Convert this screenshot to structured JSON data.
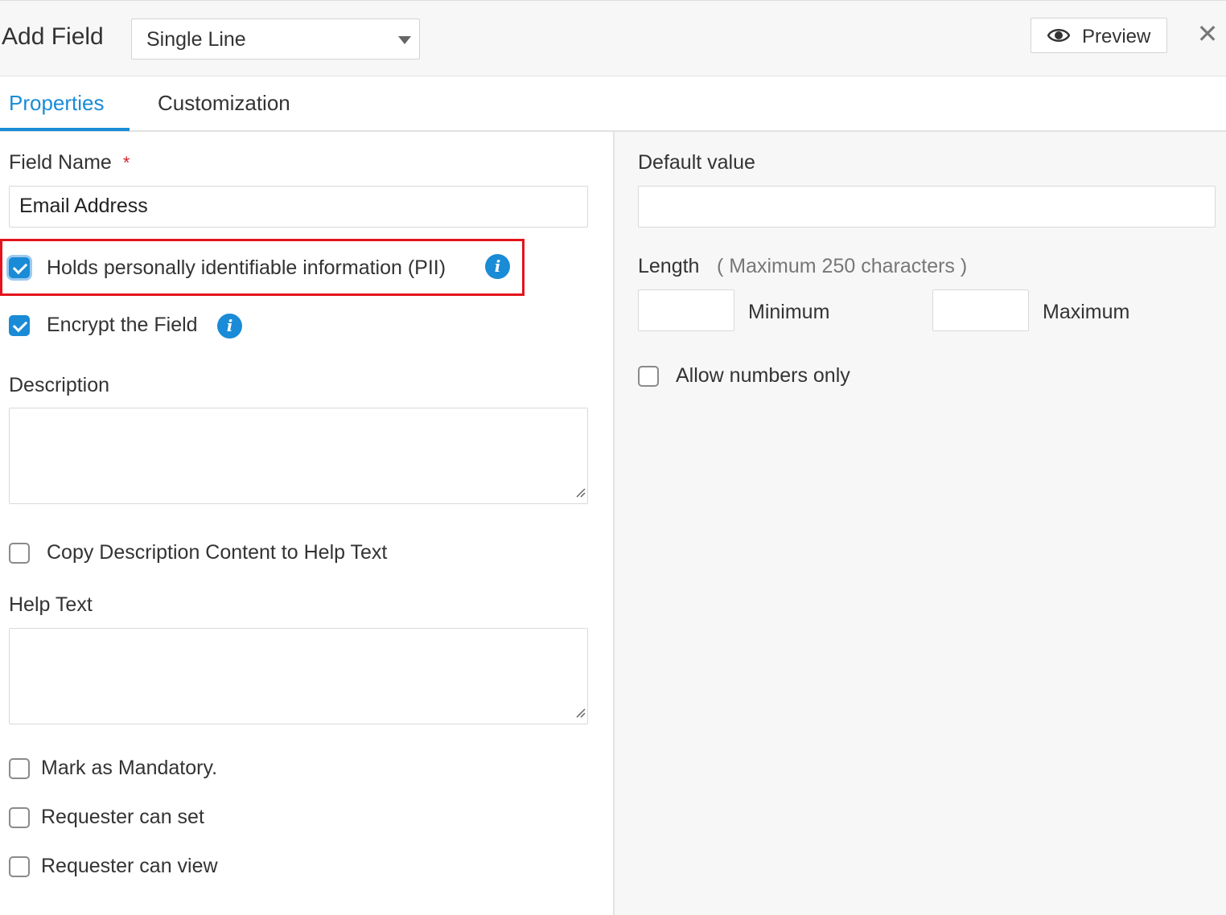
{
  "header": {
    "title": "Add Field",
    "field_type": "Single Line",
    "preview_label": "Preview",
    "close_glyph": "✕"
  },
  "tabs": [
    {
      "label": "Properties",
      "active": true
    },
    {
      "label": "Customization",
      "active": false
    }
  ],
  "left": {
    "field_name": {
      "label": "Field Name",
      "required_mark": "*",
      "value": "Email Address"
    },
    "pii": {
      "label": "Holds personally identifiable information (PII)",
      "checked": true
    },
    "encrypt": {
      "label": "Encrypt the Field",
      "checked": true
    },
    "description": {
      "label": "Description",
      "value": ""
    },
    "copy_description": {
      "label": "Copy Description Content to Help Text",
      "checked": false
    },
    "help_text": {
      "label": "Help Text",
      "value": ""
    },
    "mandatory": {
      "label": "Mark as Mandatory.",
      "checked": false
    },
    "requester_set": {
      "label": "Requester can set",
      "checked": false
    },
    "requester_view": {
      "label": "Requester can view",
      "checked": false
    }
  },
  "right": {
    "default_value": {
      "label": "Default value",
      "value": ""
    },
    "length": {
      "label": "Length",
      "hint": "( Maximum 250 characters )",
      "minimum_label": "Minimum",
      "maximum_label": "Maximum",
      "minimum_value": "",
      "maximum_value": ""
    },
    "numbers_only": {
      "label": "Allow numbers only",
      "checked": false
    }
  },
  "colors": {
    "accent": "#1a8bd6",
    "highlight_border": "#e3141c",
    "required": "#d9232d"
  },
  "icons": [
    "eye-icon",
    "close-icon",
    "info-icon",
    "checkmark-icon",
    "resize-grip-icon",
    "dropdown-caret-icon"
  ]
}
